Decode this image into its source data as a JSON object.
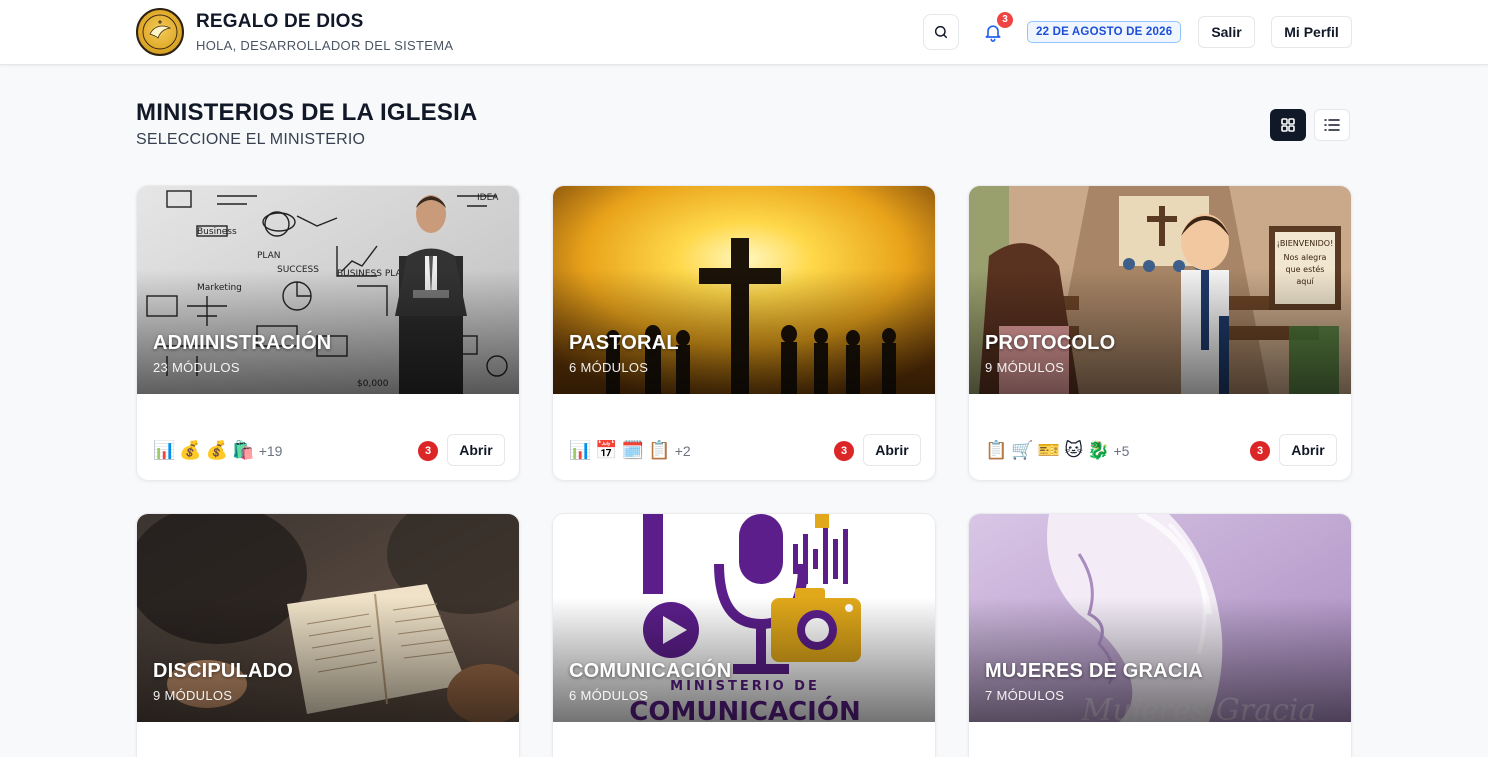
{
  "header": {
    "brand_title": "REGALO DE DIOS",
    "brand_subtitle": "HOLA, DESARROLLADOR DEL SISTEMA",
    "search_icon": "search-icon",
    "notifications_count": "3",
    "date": "22 DE AGOSTO DE 2026",
    "logout_label": "Salir",
    "profile_label": "Mi Perfil"
  },
  "page": {
    "title": "MINISTERIOS DE LA IGLESIA",
    "subtitle": "SELECCIONE EL MINISTERIO",
    "view_modes": [
      "grid-icon",
      "list-icon"
    ],
    "active_view": "grid"
  },
  "colors": {
    "accent": "#111827",
    "date_badge": "#1d4ed8",
    "alert": "#dc2626"
  },
  "ministries": [
    {
      "name": "ADMINISTRACIÓN",
      "modules": "23 MÓDULOS",
      "icons": [
        "📊",
        "💰",
        "💰",
        "🛍️"
      ],
      "more": "+19",
      "alerts": "3",
      "open_label": "Abrir"
    },
    {
      "name": "PASTORAL",
      "modules": "6 MÓDULOS",
      "icons": [
        "📊",
        "📅",
        "🗓️",
        "📋"
      ],
      "more": "+2",
      "alerts": "3",
      "open_label": "Abrir"
    },
    {
      "name": "PROTOCOLO",
      "modules": "9 MÓDULOS",
      "icons": [
        "📋",
        "🛒",
        "🎫",
        "🐱",
        "🐉"
      ],
      "more": "+5",
      "alerts": "3",
      "open_label": "Abrir"
    },
    {
      "name": "DISCIPULADO",
      "modules": "9 MÓDULOS"
    },
    {
      "name": "COMUNICACIÓN",
      "modules": "6 MÓDULOS"
    },
    {
      "name": "MUJERES DE GRACIA",
      "modules": "7 MÓDULOS"
    }
  ]
}
